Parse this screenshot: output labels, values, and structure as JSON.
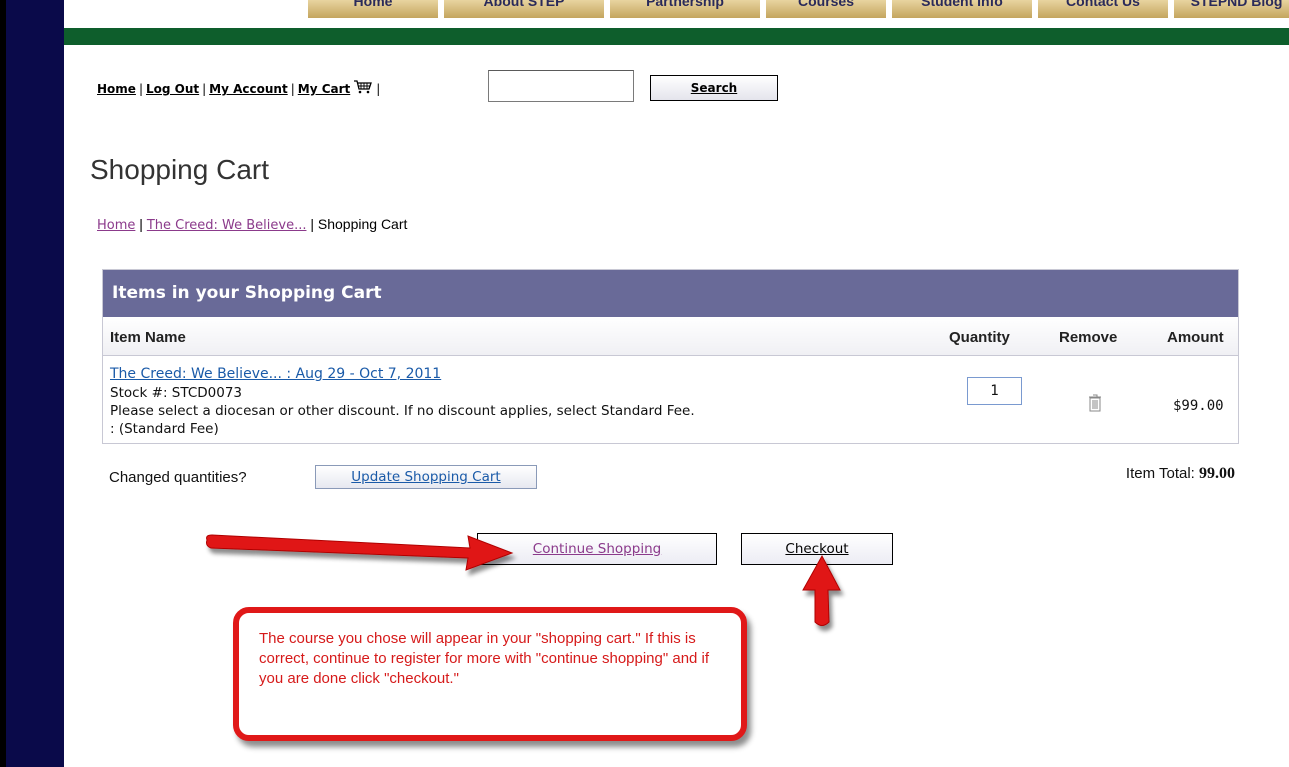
{
  "nav": {
    "tabs": [
      "Home",
      "About STEP",
      "Partnership",
      "Courses",
      "Student Info",
      "Contact Us",
      "STEPND Blog"
    ]
  },
  "top_links": {
    "home": "Home",
    "logout": "Log Out",
    "account": "My Account",
    "cart": "My Cart",
    "search_button": "Search",
    "search_value": ""
  },
  "page": {
    "title": "Shopping Cart",
    "breadcrumb": [
      "Home",
      "The Creed: We Believe...",
      "Shopping Cart"
    ]
  },
  "cart": {
    "heading": "Items in your Shopping Cart",
    "columns": [
      "Item Name",
      "Quantity",
      "Remove",
      "Amount"
    ],
    "item": {
      "name": "The Creed: We Believe... : Aug 29 - Oct 7, 2011",
      "stock": "Stock #: STCD0073",
      "note": "Please select a diocesan or other discount. If no discount applies, select Standard Fee.",
      "option": ": (Standard Fee)",
      "quantity": "1",
      "amount": "$99.00"
    },
    "changed_label": "Changed quantities?",
    "update_button": "Update Shopping Cart",
    "total_label": "Item Total: ",
    "total_value": "99.00"
  },
  "actions": {
    "continue": "Continue Shopping",
    "checkout": "Checkout"
  },
  "callout": {
    "text": "The course you chose will appear in your \"shopping cart.\" If this is correct, continue to register for more with \"continue shopping\" and if you are done click \"checkout.\""
  },
  "colors": {
    "sidebar": "#0a0a4a",
    "green_bar": "#0e5e2c",
    "cart_header": "#696a98",
    "callout_red": "#e01818",
    "link_blue": "#1a5aa8",
    "visited_purple": "#8b3a8b"
  }
}
